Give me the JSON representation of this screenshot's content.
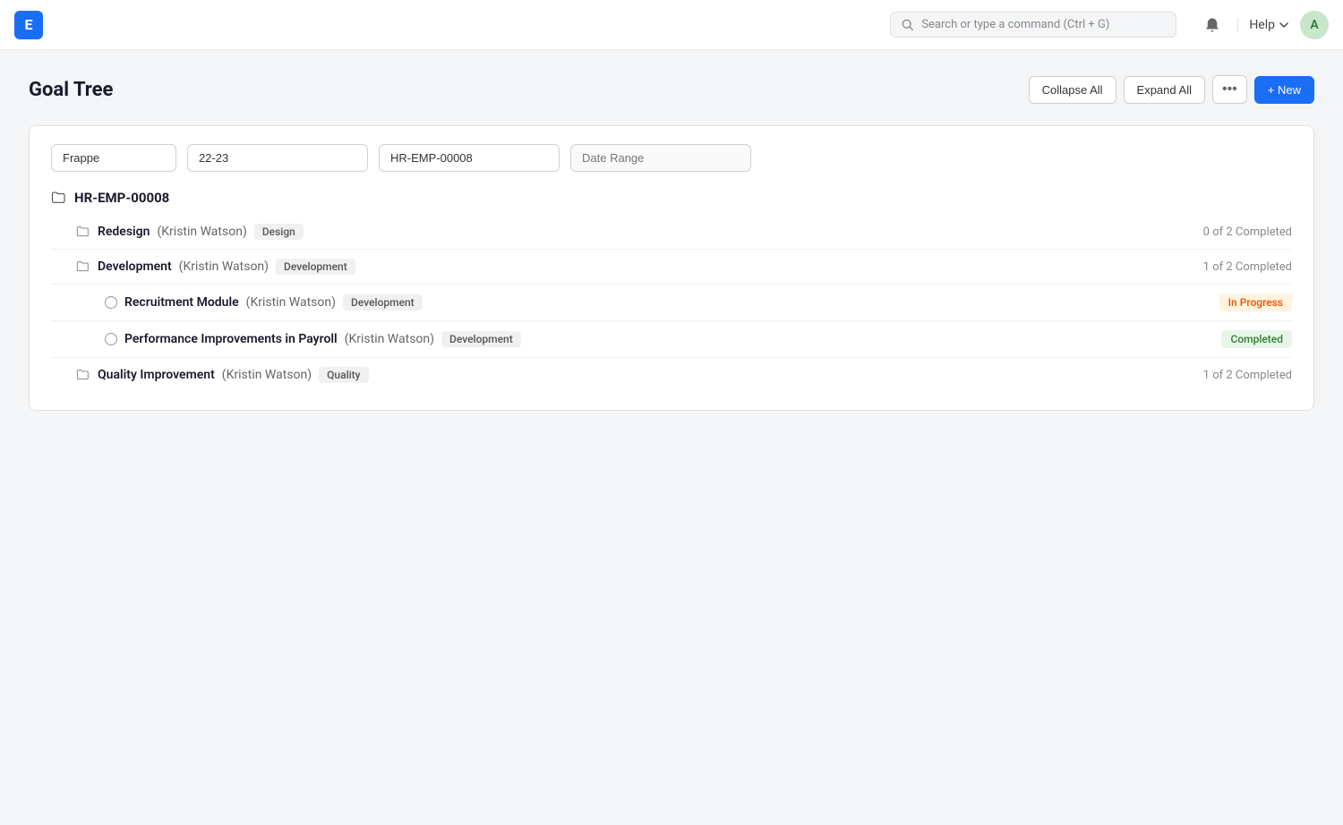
{
  "app": {
    "logo_letter": "E",
    "search_placeholder": "Search or type a command (Ctrl + G)",
    "help_label": "Help",
    "avatar_letter": "A"
  },
  "page": {
    "title": "Goal Tree",
    "collapse_all_label": "Collapse All",
    "expand_all_label": "Expand All",
    "new_label": "+ New"
  },
  "filters": {
    "company": "Frappe",
    "period": "22-23",
    "employee": "HR-EMP-00008",
    "date_range_placeholder": "Date Range"
  },
  "tree": {
    "root_id": "HR-EMP-00008",
    "items": [
      {
        "id": "redesign",
        "name": "Redesign",
        "person": "(Kristin Watson)",
        "tag": "Design",
        "indent": 1,
        "type": "group",
        "status_text": "0 of 2 Completed",
        "badge": null
      },
      {
        "id": "development",
        "name": "Development",
        "person": "(Kristin Watson)",
        "tag": "Development",
        "indent": 1,
        "type": "group",
        "status_text": "1 of 2 Completed",
        "badge": null
      },
      {
        "id": "recruitment-module",
        "name": "Recruitment Module",
        "person": "(Kristin Watson)",
        "tag": "Development",
        "indent": 2,
        "type": "item",
        "status_text": null,
        "badge": "In Progress",
        "badge_class": "badge-in-progress"
      },
      {
        "id": "performance-improvements",
        "name": "Performance Improvements in Payroll",
        "person": "(Kristin Watson)",
        "tag": "Development",
        "indent": 2,
        "type": "item",
        "status_text": null,
        "badge": "Completed",
        "badge_class": "badge-completed"
      },
      {
        "id": "quality-improvement",
        "name": "Quality Improvement",
        "person": "(Kristin Watson)",
        "tag": "Quality",
        "indent": 1,
        "type": "group",
        "status_text": "1 of 2 Completed",
        "badge": null
      }
    ]
  }
}
